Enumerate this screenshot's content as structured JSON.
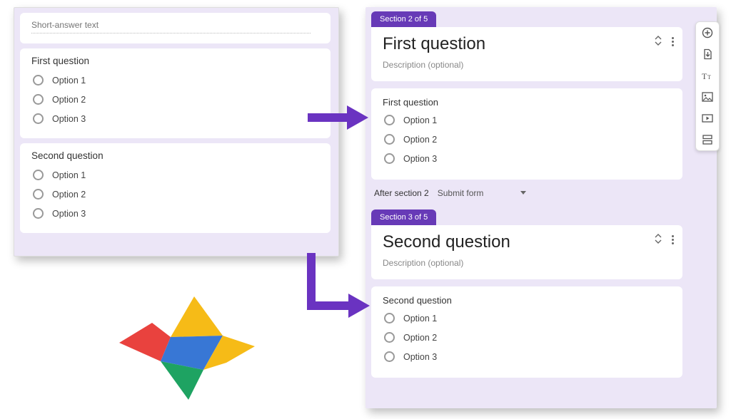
{
  "left": {
    "short_answer_placeholder": "Short-answer text",
    "q1": {
      "title": "First question",
      "options": [
        "Option 1",
        "Option 2",
        "Option 3"
      ]
    },
    "q2": {
      "title": "Second question",
      "options": [
        "Option 1",
        "Option 2",
        "Option 3"
      ]
    }
  },
  "right": {
    "sectionA": {
      "pill": "Section 2 of 5",
      "title": "First question",
      "desc": "Description (optional)",
      "q": {
        "title": "First question",
        "options": [
          "Option 1",
          "Option 2",
          "Option 3"
        ]
      },
      "after_label": "After section 2",
      "after_value": "Submit form"
    },
    "sectionB": {
      "pill": "Section 3 of 5",
      "title": "Second question",
      "desc": "Description (optional)",
      "q": {
        "title": "Second question",
        "options": [
          "Option 1",
          "Option 2",
          "Option 3"
        ]
      }
    }
  },
  "toolbar": {
    "add_question": "add-question",
    "import": "import-questions",
    "title_desc": "add-title",
    "image": "add-image",
    "video": "add-video",
    "section": "add-section"
  },
  "colors": {
    "accent": "#673ab7",
    "arrow": "#6a33c1"
  }
}
